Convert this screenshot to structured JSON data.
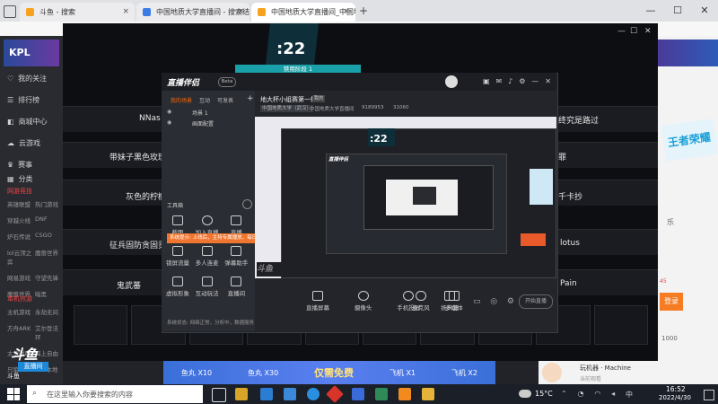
{
  "browser": {
    "tabs": [
      {
        "label": "斗鱼 - 搜索",
        "close": "×"
      },
      {
        "label": "中国地质大学直播间 - 搜索结果",
        "close": "×"
      },
      {
        "label": "中国地质大学直播间_中国地质...",
        "close": "×"
      }
    ],
    "new_tab": "+",
    "win_min": "—",
    "win_max": "☐",
    "win_close": "✕"
  },
  "video": {
    "timer": ":22",
    "phase": "禁用阶段 1",
    "brand_left": "KPL",
    "rows_left": [
      "NNas",
      "带妹子黑色玫瑰",
      "灰色的柠檬",
      "征兵固防贪固贡",
      "鬼武蕃"
    ],
    "rows_right": [
      "终究是路过",
      "罪",
      "千卡抄",
      "lotus",
      "Pain"
    ],
    "close_btn": "✕",
    "min_btn": "—",
    "max_btn": "☐",
    "douyu_logo": "斗鱼",
    "douyu_sub": "直播间",
    "banner_items": [
      "鱼丸 X10",
      "鱼丸 X30",
      "仅需免费",
      "飞机 X1",
      "飞机 X2"
    ]
  },
  "left_nav": {
    "items": [
      "我的关注",
      "排行榜",
      "商城中心",
      "云游戏",
      "赛事",
      "分类"
    ],
    "section1": "网游竞技",
    "sub1": [
      "英雄联盟",
      "热门游戏",
      "穿越火线",
      "DNF",
      "炉石传说",
      "CSGO",
      "lol云顶之弈",
      "魔兽世界",
      "网易游戏",
      "守望先锋",
      "魔兽世界",
      "暗黑"
    ],
    "section2": "单机热游",
    "sub2": [
      "主机游戏",
      "永劫无间",
      "方舟ARK",
      "艾尔登法环",
      "太荒射雕",
      "海上自由",
      "只狼",
      "123本地"
    ]
  },
  "app": {
    "logo": "直播伴侣",
    "beta": "Beta",
    "stream_title": "地大杯小组赛第一轮",
    "badge": "我的",
    "room_tag": "中国地质大学（武汉）",
    "room_name": "中国地质大学直播间",
    "viewer_count": "9189953",
    "likes": "31060",
    "side_tabs": [
      "我的场景",
      "互动",
      "可发表"
    ],
    "scenes": [
      "场景 1",
      "画面配置"
    ],
    "tool_label": "工具箱",
    "tools": [
      "截图",
      "加入直播",
      "直播",
      "锁屏流量",
      "多人连麦",
      "弹幕助手",
      "虚拟形象",
      "互动玩法",
      "直播间",
      "多媒体",
      "全麦",
      "互动"
    ],
    "notice": "系统提示: 上线后，主持专属播放，每日登陆成为主播，登入地址",
    "bottom_tools": [
      "直播屏幕",
      "摄像头",
      "手机投屏",
      "多媒体",
      "麦克风",
      "扬声器"
    ],
    "status_text": "系统状态: 网络正常，分析中，数据服务",
    "start_btn": "开始直播",
    "nested_timer": ":22",
    "nested_logo": "直播伴侣"
  },
  "right_panel": {
    "logo": "王者荣耀",
    "chat_label": "乐",
    "btn": "登录",
    "count": "45",
    "list_num": "1000",
    "user": "玩机器 · Machine",
    "user_sub": "当前观看"
  },
  "taskbar": {
    "search_placeholder": "在这里输入你要搜索的内容",
    "temp": "15°C",
    "time": "16:52",
    "date": "2022/4/30",
    "ime": "中",
    "corner": "斗鱼"
  }
}
